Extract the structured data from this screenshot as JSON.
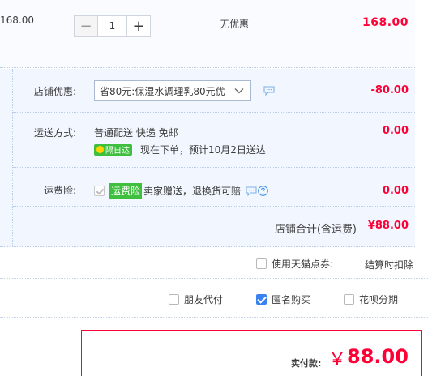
{
  "item": {
    "unit_price": "168.00",
    "quantity": "1",
    "minus_symbol": "−",
    "plus_symbol": "+",
    "discount": "无优惠",
    "subtotal": "168.00"
  },
  "shop": {
    "discount_label": "店铺优惠:",
    "discount_select": "省80元:保湿水调理乳80元优",
    "discount_amount": "-80.00",
    "shipping_label": "运送方式:",
    "shipping_method": "普通配送 快递 免邮",
    "next_day_badge": "隔日达",
    "delivery_eta": "现在下单，预计10月2日送达",
    "shipping_fee": "0.00",
    "insurance_label": "运费险:",
    "insurance_tag": "运费险",
    "insurance_desc": "卖家赠送，退换货可赔",
    "insurance_fee": "0.00",
    "total_label": "店铺合计(含运费)",
    "total_value": "¥88.00"
  },
  "tmall_points": {
    "label": "使用天猫点券:",
    "note": "结算时扣除"
  },
  "options": {
    "friend_pay": "朋友代付",
    "anonymous": "匿名购买",
    "huabei": "花呗分期"
  },
  "payment": {
    "label": "实付款:",
    "currency": "￥",
    "amount": "88.00"
  },
  "colors": {
    "price_red": "#ff0036",
    "panel_blue": "#f2f7ff",
    "badge_green": "#3ebf3e",
    "check_blue": "#3a82f0"
  },
  "icons": {
    "chat": "chat-bubble-icon",
    "help": "question-circle-icon",
    "chevron": "chevron-down-icon",
    "bolt": "lightning-icon"
  }
}
